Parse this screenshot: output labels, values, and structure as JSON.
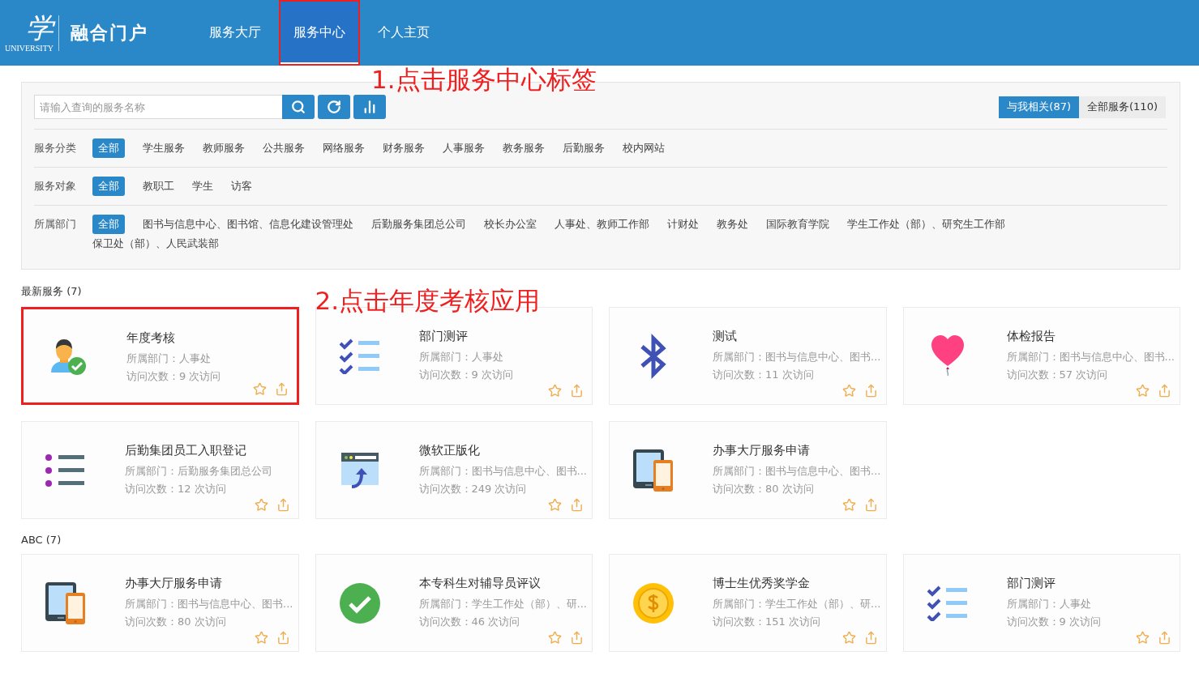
{
  "header": {
    "logo_text": "学",
    "logo_subtext": "UNIVERSITY",
    "brand": "融合门户",
    "tabs": [
      {
        "label": "服务大厅",
        "selected": false,
        "marked": false
      },
      {
        "label": "服务中心",
        "selected": true,
        "marked": true,
        "annotation": "1.点击服务中心标签"
      },
      {
        "label": "个人主页",
        "selected": false,
        "marked": false
      }
    ]
  },
  "search": {
    "placeholder": "请输入查询的服务名称"
  },
  "scope": [
    {
      "label": "与我相关(87)",
      "selected": true
    },
    {
      "label": "全部服务(110)",
      "selected": false
    }
  ],
  "filters": [
    {
      "label": "服务分类",
      "options": [
        {
          "label": "全部",
          "selected": true
        },
        {
          "label": "学生服务",
          "selected": false
        },
        {
          "label": "教师服务",
          "selected": false
        },
        {
          "label": "公共服务",
          "selected": false
        },
        {
          "label": "网络服务",
          "selected": false
        },
        {
          "label": "财务服务",
          "selected": false
        },
        {
          "label": "人事服务",
          "selected": false
        },
        {
          "label": "教务服务",
          "selected": false
        },
        {
          "label": "后勤服务",
          "selected": false
        },
        {
          "label": "校内网站",
          "selected": false
        }
      ]
    },
    {
      "label": "服务对象",
      "options": [
        {
          "label": "全部",
          "selected": true
        },
        {
          "label": "教职工",
          "selected": false
        },
        {
          "label": "学生",
          "selected": false
        },
        {
          "label": "访客",
          "selected": false
        }
      ]
    },
    {
      "label": "所属部门",
      "options": [
        {
          "label": "全部",
          "selected": true
        },
        {
          "label": "图书与信息中心、图书馆、信息化建设管理处",
          "selected": false
        },
        {
          "label": "后勤服务集团总公司",
          "selected": false
        },
        {
          "label": "校长办公室",
          "selected": false
        },
        {
          "label": "人事处、教师工作部",
          "selected": false
        },
        {
          "label": "计财处",
          "selected": false
        },
        {
          "label": "教务处",
          "selected": false
        },
        {
          "label": "国际教育学院",
          "selected": false
        },
        {
          "label": "学生工作处（部）、研究生工作部",
          "selected": false
        },
        {
          "label": "保卫处（部）、人民武装部",
          "selected": false
        }
      ]
    }
  ],
  "sections": [
    {
      "title": "最新服务 (7)",
      "cards": [
        {
          "title": "年度考核",
          "dept": "所属部门：人事处",
          "visits": "访问次数：9 次访问",
          "marked": true,
          "annotation": "2.点击年度考核应用"
        },
        {
          "title": "部门测评",
          "dept": "所属部门：人事处",
          "visits": "访问次数：9 次访问",
          "marked": false
        },
        {
          "title": "测试",
          "dept": "所属部门：图书与信息中心、图书...",
          "visits": "访问次数：11 次访问",
          "marked": false
        },
        {
          "title": "体检报告",
          "dept": "所属部门：图书与信息中心、图书...",
          "visits": "访问次数：57 次访问",
          "marked": false
        },
        {
          "title": "后勤集团员工入职登记",
          "dept": "所属部门：后勤服务集团总公司",
          "visits": "访问次数：12 次访问",
          "marked": false
        },
        {
          "title": "微软正版化",
          "dept": "所属部门：图书与信息中心、图书...",
          "visits": "访问次数：249 次访问",
          "marked": false
        },
        {
          "title": "办事大厅服务申请",
          "dept": "所属部门：图书与信息中心、图书...",
          "visits": "访问次数：80 次访问",
          "marked": false
        }
      ]
    },
    {
      "title": "ABC (7)",
      "cards": [
        {
          "title": "办事大厅服务申请",
          "dept": "所属部门：图书与信息中心、图书...",
          "visits": "访问次数：80 次访问",
          "marked": false
        },
        {
          "title": "本专科生对辅导员评议",
          "dept": "所属部门：学生工作处（部）、研...",
          "visits": "访问次数：46 次访问",
          "marked": false
        },
        {
          "title": "博士生优秀奖学金",
          "dept": "所属部门：学生工作处（部）、研...",
          "visits": "访问次数：151 次访问",
          "marked": false
        },
        {
          "title": "部门测评",
          "dept": "所属部门：人事处",
          "visits": "访问次数：9 次访问",
          "marked": false
        }
      ]
    }
  ]
}
